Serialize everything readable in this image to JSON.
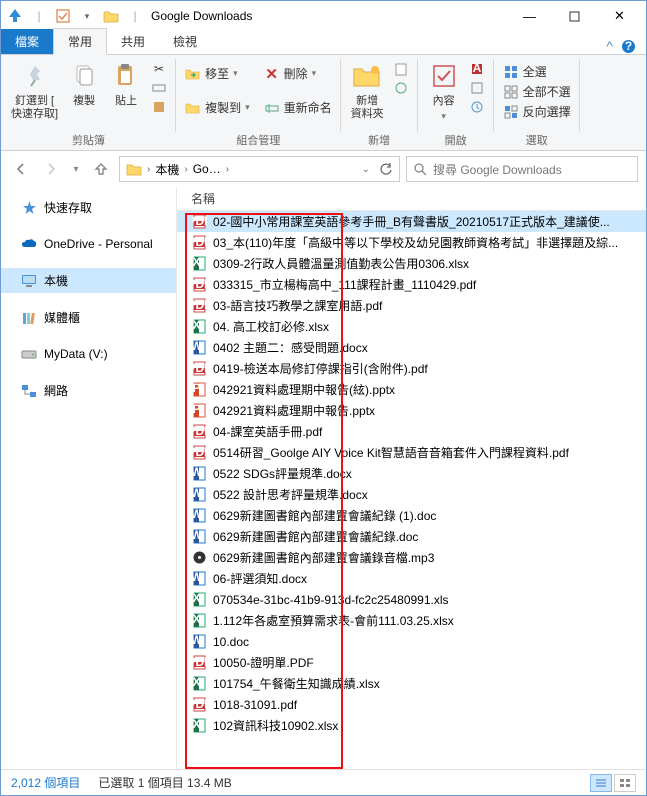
{
  "window": {
    "title": "Google Downloads"
  },
  "tabs": {
    "file": "檔案",
    "home": "常用",
    "share": "共用",
    "view": "檢視"
  },
  "ribbon": {
    "clipboard": {
      "pin": "釘選到 [\n快速存取]",
      "copy": "複製",
      "paste": "貼上",
      "label": "剪貼簿"
    },
    "organize": {
      "moveto": "移至",
      "copyto": "複製到",
      "delete": "刪除",
      "rename": "重新命名",
      "label": "組合管理"
    },
    "new": {
      "newfolder": "新增\n資料夾",
      "label": "新增"
    },
    "open": {
      "properties": "內容",
      "label": "開啟"
    },
    "select": {
      "selectall": "全選",
      "selectnone": "全部不選",
      "invert": "反向選擇",
      "label": "選取"
    }
  },
  "breadcrumb": {
    "seg1": "本機",
    "seg2": "Go…"
  },
  "search": {
    "placeholder": "搜尋 Google Downloads"
  },
  "nav": {
    "quick": "快速存取",
    "onedrive": "OneDrive - Personal",
    "thispc": "本機",
    "media": "媒體櫃",
    "mydata": "MyData (V:)",
    "network": "網路"
  },
  "columns": {
    "name": "名稱"
  },
  "files": [
    {
      "icon": "pdf",
      "name": "02-國中小常用課室英語參考手冊_B有聲書版_20210517正式版本_建議使...",
      "sel": true
    },
    {
      "icon": "pdf",
      "name": "03_本(110)年度「高級中等以下學校及幼兒園教師資格考試」非選擇題及綜..."
    },
    {
      "icon": "xls",
      "name": "0309-2行政人員體溫量測值勤表公告用0306.xlsx"
    },
    {
      "icon": "pdf",
      "name": "033315_市立楊梅高中_111課程計畫_1110429.pdf"
    },
    {
      "icon": "pdf",
      "name": "03-語言技巧教學之課室用語.pdf"
    },
    {
      "icon": "xls",
      "name": "04. 高工校訂必修.xlsx"
    },
    {
      "icon": "doc",
      "name": "0402 主題二：感受問題.docx"
    },
    {
      "icon": "pdf",
      "name": "0419-檢送本局修訂停課指引(含附件).pdf"
    },
    {
      "icon": "ppt",
      "name": "042921資料處理期中報告(絃).pptx"
    },
    {
      "icon": "ppt",
      "name": "042921資料處理期中報告.pptx"
    },
    {
      "icon": "pdf",
      "name": "04-課室英語手冊.pdf"
    },
    {
      "icon": "pdf",
      "name": "0514研習_Goolge AIY Voice Kit智慧語音音箱套件入門課程資料.pdf"
    },
    {
      "icon": "doc",
      "name": "0522 SDGs評量規準.docx"
    },
    {
      "icon": "doc",
      "name": "0522 設計思考評量規準.docx"
    },
    {
      "icon": "doc",
      "name": "0629新建圖書館內部建置會議紀錄 (1).doc"
    },
    {
      "icon": "doc",
      "name": "0629新建圖書館內部建置會議紀錄.doc"
    },
    {
      "icon": "mp3",
      "name": "0629新建圖書館內部建置會議錄音檔.mp3"
    },
    {
      "icon": "doc",
      "name": "06-評選須知.docx"
    },
    {
      "icon": "xls",
      "name": "070534e-31bc-41b9-913d-fc2c25480991.xls"
    },
    {
      "icon": "xls",
      "name": "1.112年各處室預算需求表-會前111.03.25.xlsx"
    },
    {
      "icon": "doc",
      "name": "10.doc"
    },
    {
      "icon": "pdf",
      "name": "10050-證明單.PDF"
    },
    {
      "icon": "xls",
      "name": "101754_午餐衛生知識成績.xlsx"
    },
    {
      "icon": "pdf",
      "name": "1018-31091.pdf"
    },
    {
      "icon": "xls",
      "name": "102資訊科技10902.xlsx"
    }
  ],
  "status": {
    "items": "2,012 個項目",
    "selected": "已選取 1 個項目 13.4 MB"
  }
}
